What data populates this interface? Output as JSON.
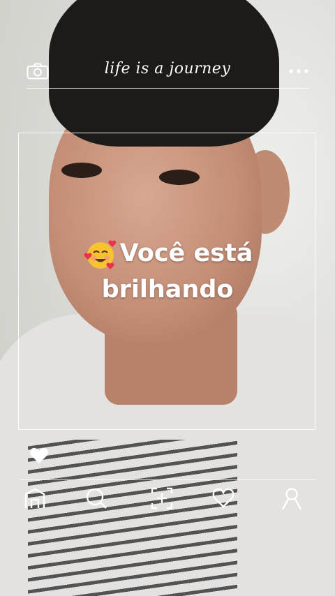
{
  "header": {
    "tagline": "life is a journey",
    "camera_icon": "camera-icon",
    "more_icon": "more-dots-icon"
  },
  "post": {
    "caption_emoji": "smiling-face-with-hearts",
    "caption_line1": "Você está",
    "caption_line2": "brilhando",
    "like_icon": "heart-icon"
  },
  "nav": {
    "items": [
      {
        "name": "home",
        "icon": "home-icon"
      },
      {
        "name": "search",
        "icon": "search-icon"
      },
      {
        "name": "add",
        "icon": "add-post-icon"
      },
      {
        "name": "likes",
        "icon": "heart-outline-icon"
      },
      {
        "name": "profile",
        "icon": "profile-icon"
      }
    ]
  },
  "colors": {
    "overlay": "#ffffff",
    "wall": "#dcdcd8",
    "shirt": "#e3e2e0"
  }
}
